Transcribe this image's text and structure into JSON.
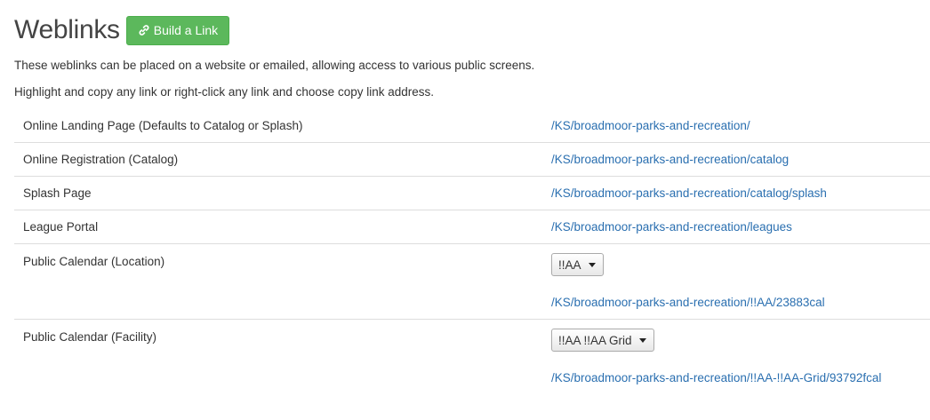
{
  "header": {
    "title": "Weblinks",
    "build_button_label": "Build a Link"
  },
  "intro": {
    "line1": "These weblinks can be placed on a website or emailed, allowing access to various public screens.",
    "line2": "Highlight and copy any link or right-click any link and choose copy link address."
  },
  "rows": [
    {
      "label": "Online Landing Page (Defaults to Catalog or Splash)",
      "link": "/KS/broadmoor-parks-and-recreation/"
    },
    {
      "label": "Online Registration (Catalog)",
      "link": "/KS/broadmoor-parks-and-recreation/catalog"
    },
    {
      "label": "Splash Page",
      "link": "/KS/broadmoor-parks-and-recreation/catalog/splash"
    },
    {
      "label": "League Portal",
      "link": "/KS/broadmoor-parks-and-recreation/leagues"
    },
    {
      "label": "Public Calendar (Location)",
      "select_value": "!!AA",
      "link": "/KS/broadmoor-parks-and-recreation/!!AA/23883cal"
    },
    {
      "label": "Public Calendar (Facility)",
      "select_value": "!!AA !!AA Grid",
      "link": "/KS/broadmoor-parks-and-recreation/!!AA-!!AA-Grid/93792fcal"
    }
  ],
  "colors": {
    "button_green": "#5cb85c",
    "link_blue": "#2a6fb0"
  },
  "icons": {
    "build_button": "link-icon",
    "select": "caret-down-icon"
  }
}
